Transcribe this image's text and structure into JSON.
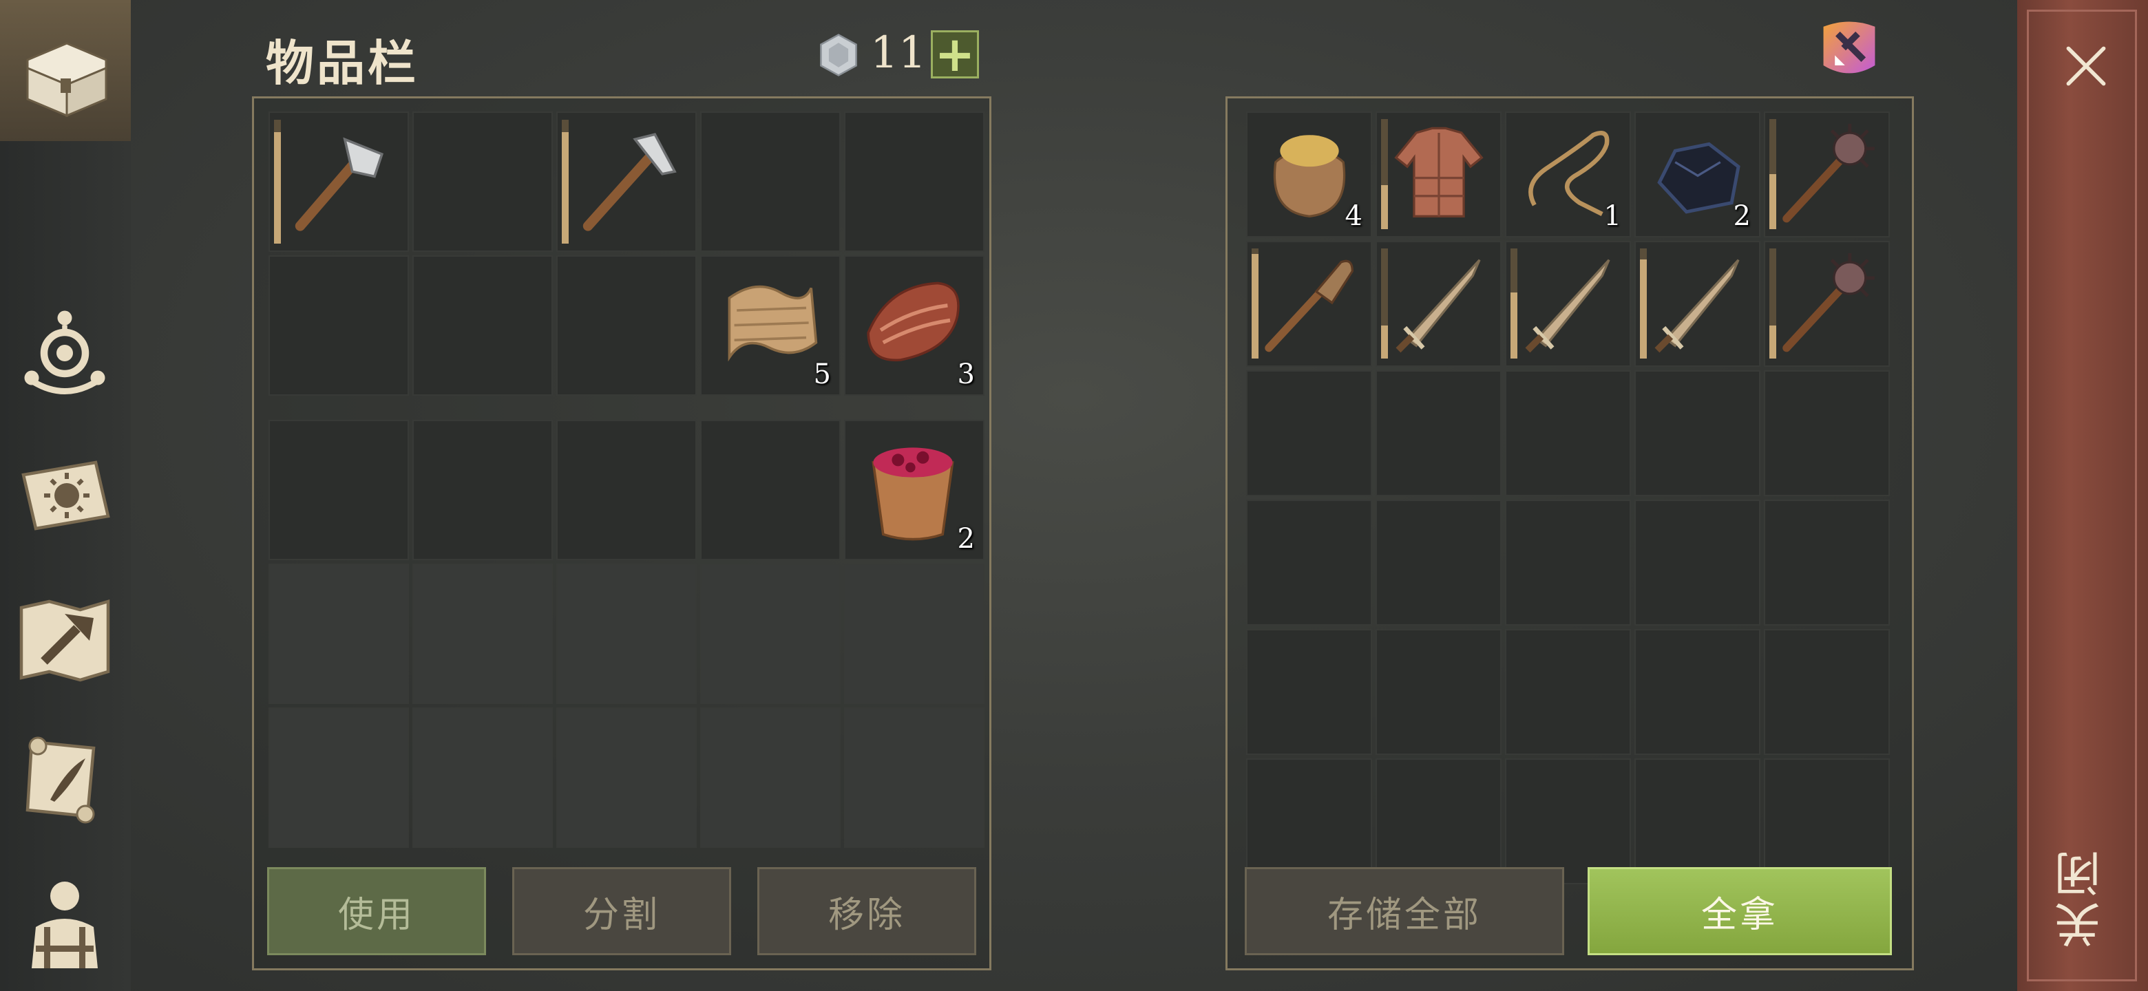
{
  "sidebar": {
    "items": [
      {
        "icon": "chest-icon",
        "active": true
      },
      {
        "icon": "skills-icon"
      },
      {
        "icon": "journal-icon"
      },
      {
        "icon": "crafting-map-icon"
      },
      {
        "icon": "scroll-quill-icon"
      },
      {
        "icon": "character-icon"
      }
    ]
  },
  "inventory": {
    "title": "物品栏",
    "coins": "11",
    "add_coin_label": "+",
    "slots_top": [
      {
        "icon": "stone-hatchet-icon",
        "count": "",
        "durability": 0.9
      },
      {
        "icon": "",
        "count": ""
      },
      {
        "icon": "stone-pickaxe-icon",
        "count": "",
        "durability": 0.9
      },
      {
        "icon": "",
        "count": ""
      },
      {
        "icon": "",
        "count": ""
      },
      {
        "icon": "",
        "count": ""
      },
      {
        "icon": "",
        "count": ""
      },
      {
        "icon": "",
        "count": ""
      },
      {
        "icon": "cloth-icon",
        "count": "5"
      },
      {
        "icon": "raw-meat-icon",
        "count": "3"
      }
    ],
    "slots_bottom": [
      {
        "icon": "",
        "count": ""
      },
      {
        "icon": "",
        "count": ""
      },
      {
        "icon": "",
        "count": ""
      },
      {
        "icon": "",
        "count": ""
      },
      {
        "icon": "berry-bucket-icon",
        "count": "2"
      }
    ],
    "buttons": {
      "use": "使用",
      "split": "分割",
      "remove": "移除"
    }
  },
  "container": {
    "sort_icon": "auto-sort-icon",
    "slots": [
      {
        "icon": "grain-sack-icon",
        "count": "4"
      },
      {
        "icon": "leather-armor-icon",
        "count": "",
        "durability": 0.4
      },
      {
        "icon": "rope-icon",
        "count": "1"
      },
      {
        "icon": "coal-icon",
        "count": "2"
      },
      {
        "icon": "spiked-mace-icon",
        "count": "",
        "durability": 0.5
      },
      {
        "icon": "wooden-club-icon",
        "count": "",
        "durability": 0.95
      },
      {
        "icon": "sword-icon",
        "count": "",
        "durability": 0.3
      },
      {
        "icon": "sword-icon",
        "count": "",
        "durability": 0.6
      },
      {
        "icon": "sword-icon",
        "count": "",
        "durability": 0.9
      },
      {
        "icon": "spiked-mace-icon",
        "count": "",
        "durability": 0.3
      }
    ],
    "buttons": {
      "store_all": "存储全部",
      "take_all": "全拿"
    }
  },
  "close": {
    "label": "关闭",
    "icon": "close-icon"
  },
  "colors": {
    "accent_green": "#9bbf58",
    "panel_border": "#857a5f",
    "close_bar": "#7c4436"
  }
}
